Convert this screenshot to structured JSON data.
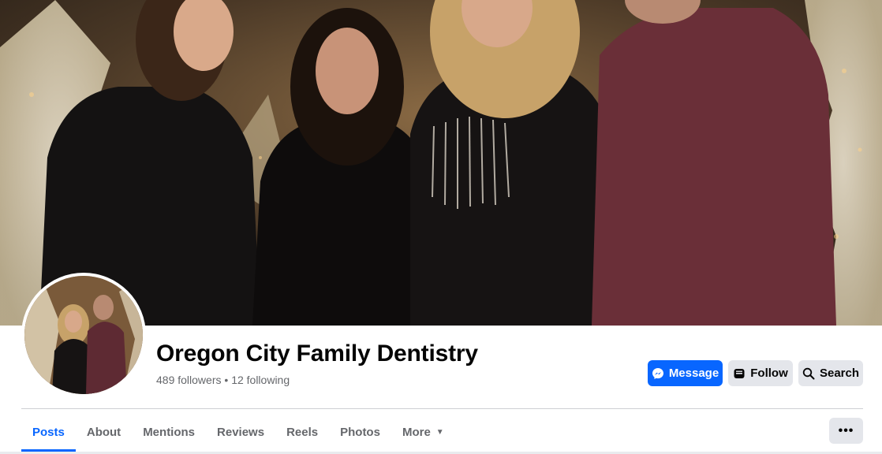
{
  "page": {
    "name": "Oregon City Family Dentistry",
    "followers": "489 followers",
    "separator": " • ",
    "following": "12 following"
  },
  "actions": {
    "message_label": "Message",
    "follow_label": "Follow",
    "search_label": "Search"
  },
  "tabs": [
    {
      "label": "Posts",
      "active": true
    },
    {
      "label": "About",
      "active": false
    },
    {
      "label": "Mentions",
      "active": false
    },
    {
      "label": "Reviews",
      "active": false
    },
    {
      "label": "Reels",
      "active": false
    },
    {
      "label": "Photos",
      "active": false
    },
    {
      "label": "More",
      "active": false
    }
  ],
  "more_options": "•••",
  "colors": {
    "accent": "#0866ff",
    "secondary_button": "#e4e6eb",
    "muted_text": "#65676b",
    "cover_background": "#3f3020"
  },
  "icons": {
    "message": "messenger-icon",
    "follow": "follow-icon",
    "search": "search-icon",
    "more_caret": "caret-down-icon",
    "more_options": "more-options-icon"
  }
}
